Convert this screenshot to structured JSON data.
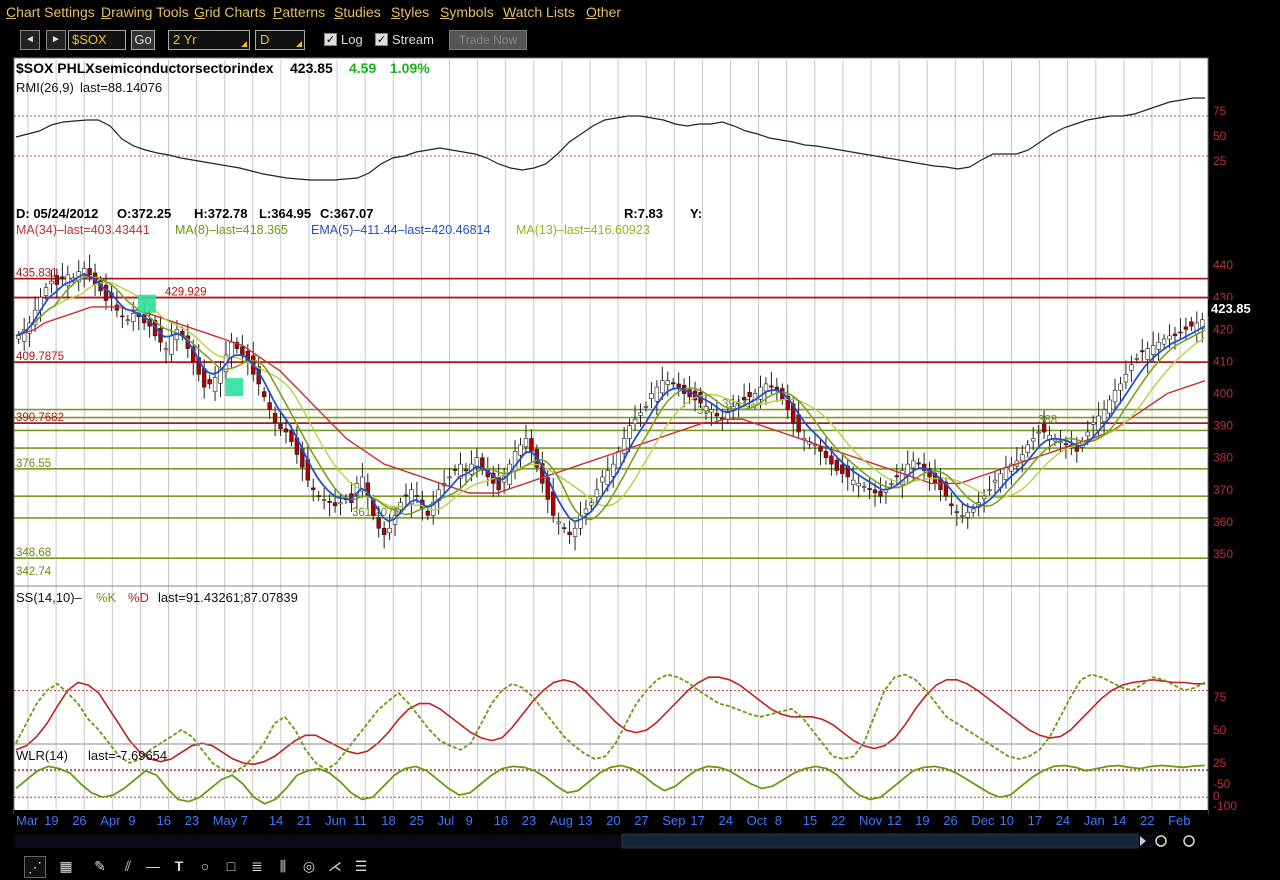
{
  "menu": [
    "Chart Settings",
    "Drawing Tools",
    "Grid Charts",
    "Patterns",
    "Studies",
    "Styles",
    "Symbols",
    "Watch Lists",
    "Other"
  ],
  "toolbar": {
    "back_label": "◄",
    "forward_label": "►",
    "symbol": "$SOX",
    "go_label": "Go",
    "period": "2 Yr",
    "interval": "D",
    "log_label": "Log",
    "log_checked": "✓",
    "stream_label": "Stream",
    "stream_checked": "✓",
    "trade_label": "Trade Now"
  },
  "colors": {
    "accent_menu": "#e8c05a",
    "price_up": "#ffffff",
    "price_down": "#b00000",
    "ma34": "#c83030",
    "ma8": "#7aa020",
    "ema5": "#2050d0",
    "ma13": "#b8d040",
    "rmi": "#222222",
    "k_line": "#6a9a10",
    "d_line": "#c02020",
    "level_red": "#b01818",
    "level_green": "#7a9a20",
    "signal_box": "#2ee0a0"
  },
  "chart_data": [
    {
      "type": "line",
      "panel": "price-header",
      "title": "$SOX PHLXsemiconductorsectorindex",
      "last": "423.85",
      "change": "4.59",
      "change_pct": "1.09%",
      "readout": {
        "date": "05/24/2012",
        "open": "372.25",
        "high": "372.78",
        "low": "364.95",
        "close": "367.07",
        "r": "R:7.83",
        "y": "Y:"
      }
    },
    {
      "type": "line",
      "panel": "rmi",
      "legend": "RMI(26,9)",
      "last_label": "last=88.14076",
      "ylim": [
        0,
        100
      ],
      "yticks": [
        25,
        50,
        75
      ],
      "reference_lines": [
        30,
        70
      ],
      "x": [
        0,
        4,
        8,
        12,
        16,
        20,
        24,
        28,
        32,
        36,
        40,
        44,
        48,
        52,
        56,
        60,
        64,
        68,
        72,
        76,
        80,
        84,
        88,
        92,
        96,
        100,
        104,
        108,
        112,
        116,
        120,
        124,
        128,
        132,
        136,
        140,
        144,
        148,
        152,
        156,
        160,
        164,
        168,
        172,
        176,
        180,
        184,
        188,
        192,
        196,
        200,
        204,
        208,
        212,
        216,
        220,
        224,
        228,
        232,
        236,
        240,
        244,
        248,
        252,
        256,
        260,
        264,
        268,
        272,
        276,
        280,
        284,
        288,
        292,
        296,
        300,
        304,
        308,
        312,
        316,
        320,
        324,
        328,
        332,
        336,
        340,
        344,
        348,
        352
      ],
      "values": [
        49,
        52,
        55,
        61,
        64,
        65,
        66,
        66,
        60,
        47,
        40,
        36,
        33,
        31,
        28,
        26,
        24,
        22,
        20,
        18,
        15,
        12,
        10,
        8,
        7,
        6,
        6,
        6,
        7,
        8,
        13,
        22,
        28,
        30,
        34,
        36,
        38,
        36,
        34,
        32,
        28,
        22,
        18,
        16,
        18,
        22,
        32,
        44,
        52,
        60,
        66,
        68,
        70,
        70,
        68,
        66,
        62,
        60,
        62,
        62,
        64,
        60,
        55,
        52,
        48,
        46,
        44,
        41,
        40,
        38,
        36,
        34,
        32,
        30,
        28,
        26,
        24,
        22,
        20,
        19,
        17,
        19,
        26,
        32,
        32,
        32,
        36,
        44,
        52,
        58,
        62,
        66,
        68,
        70,
        70,
        72,
        76,
        80,
        84,
        86,
        88,
        88
      ]
    },
    {
      "type": "line",
      "panel": "price",
      "date_readout": "D: 05/24/2012",
      "legends": [
        {
          "name": "MA(34)",
          "last": "last=403.43441"
        },
        {
          "name": "MA(8)",
          "last": "last=418.365"
        },
        {
          "name": "EMA(5)",
          "value": "411.44",
          "last": "last=420.46814"
        },
        {
          "name": "MA(13)",
          "last": "last=416.60923"
        }
      ],
      "ylim": [
        340,
        446
      ],
      "yticks": [
        350,
        360,
        370,
        380,
        390,
        400,
        410,
        420,
        430,
        440
      ],
      "last_price_tag": "423.85",
      "levels_red": [
        435.83,
        429.929,
        409.7875,
        390.7682
      ],
      "levels_green": [
        395,
        392.5,
        388.5,
        383,
        376.55,
        368,
        361.2071,
        348.68
      ],
      "level_labels": [
        {
          "text": "435.831",
          "value": 435.83
        },
        {
          "text": "429.929",
          "value": 429.929
        },
        {
          "text": "409.7875",
          "value": 409.7875
        },
        {
          "text": "390.7682",
          "value": 390.7682
        },
        {
          "text": "376.55",
          "value": 376.55
        },
        {
          "text": "361.2071",
          "value": 361.2071
        },
        {
          "text": "348.68",
          "value": 348.68
        },
        {
          "text": "342.74",
          "value": 342.74
        },
        {
          "text": "394.03",
          "value": 395
        },
        {
          "text": "39",
          "value": 393
        },
        {
          "text": "388",
          "value": 390
        }
      ],
      "signal_boxes": [
        {
          "x_index": 24,
          "value": 428
        },
        {
          "x_index": 40,
          "value": 402
        },
        {
          "x_index": 266,
          "value": 388
        }
      ],
      "close": [
        418,
        420,
        422,
        426,
        430,
        433,
        435,
        434,
        436,
        437,
        436,
        438,
        439,
        437,
        434,
        432,
        429,
        430,
        426,
        424,
        423,
        425,
        424,
        422,
        421,
        418,
        416,
        414,
        418,
        420,
        418,
        414,
        410,
        406,
        402,
        403,
        405,
        408,
        412,
        416,
        414,
        412,
        410,
        406,
        403,
        399,
        395,
        391,
        389,
        388,
        385,
        381,
        377,
        373,
        370,
        368,
        367,
        366,
        365,
        366,
        367,
        366,
        372,
        374,
        368,
        362,
        358,
        356,
        358,
        362,
        366,
        368,
        370,
        368,
        364,
        362,
        366,
        370,
        372,
        374,
        376,
        378,
        376,
        378,
        380,
        376,
        374,
        372,
        370,
        374,
        378,
        382,
        384,
        386,
        382,
        377,
        372,
        367,
        362,
        360,
        358,
        356,
        358,
        362,
        364,
        366,
        370,
        374,
        376,
        378,
        382,
        386,
        390,
        392,
        394,
        396,
        400,
        402,
        404,
        404,
        403,
        402,
        400,
        399,
        398,
        397,
        396,
        395,
        393,
        392,
        394,
        396,
        397,
        398,
        399,
        400,
        402,
        403,
        402,
        401,
        398,
        395,
        391,
        388,
        386,
        385,
        384,
        382,
        380,
        378,
        376,
        375,
        374,
        373,
        372,
        371,
        370,
        369,
        368,
        370,
        372,
        374,
        376,
        378,
        379,
        378,
        376,
        374,
        372,
        370,
        368,
        365,
        363,
        362,
        363,
        364,
        366,
        368,
        370,
        373,
        375,
        377,
        378,
        379,
        381,
        384,
        386,
        388,
        388,
        387,
        386,
        385,
        384,
        383,
        382,
        385,
        388,
        391,
        393,
        395,
        398,
        401,
        403,
        406,
        409,
        411,
        413,
        414,
        415,
        416,
        417,
        418,
        418,
        419,
        420,
        421,
        422,
        423
      ],
      "ma34": [
        418,
        419,
        420,
        422,
        423,
        424,
        425,
        426,
        427,
        427,
        427,
        427,
        426,
        426,
        425,
        424,
        423,
        422,
        421,
        420,
        419,
        418,
        417,
        416,
        415,
        413,
        411,
        409,
        407,
        404,
        401,
        398,
        395,
        392,
        389,
        386,
        384,
        382,
        380,
        378,
        377,
        376,
        375,
        374,
        373,
        372,
        371,
        370,
        369,
        369,
        369,
        369,
        370,
        371,
        372,
        373,
        374,
        375,
        376,
        377,
        378,
        379,
        380,
        381,
        382,
        383,
        384,
        385,
        386,
        387,
        388,
        389,
        390,
        391,
        391,
        392,
        392,
        392,
        391,
        390,
        389,
        388,
        387,
        386,
        385,
        384,
        383,
        382,
        381,
        380,
        379,
        378,
        377,
        376,
        375,
        374,
        373,
        372,
        372,
        372,
        372,
        373,
        374,
        375,
        376,
        377,
        378,
        379,
        380,
        381,
        382,
        383,
        384,
        385,
        386,
        387,
        388,
        390,
        392,
        394,
        396,
        398,
        400,
        401,
        402,
        403,
        404
      ],
      "x_labels": [
        "Mar",
        "19",
        "26",
        "Apr",
        "9",
        "16",
        "23",
        "May",
        "7",
        "14",
        "21",
        "Jun",
        "11",
        "18",
        "25",
        "Jul",
        "9",
        "16",
        "23",
        "Aug",
        "13",
        "20",
        "27",
        "Sep",
        "17",
        "24",
        "Oct",
        "8",
        "15",
        "22",
        "Nov",
        "12",
        "19",
        "26",
        "Dec",
        "10",
        "17",
        "24",
        "Jan",
        "14",
        "22",
        "Feb"
      ]
    },
    {
      "type": "line",
      "panel": "stochastic",
      "legend": "SS(14,10)",
      "series": [
        {
          "name": "%K",
          "values": [
            40,
            55,
            70,
            80,
            85,
            78,
            70,
            58,
            50,
            40,
            30,
            25,
            28,
            35,
            40,
            45,
            50,
            45,
            35,
            25,
            20,
            18,
            22,
            30,
            40,
            55,
            60,
            50,
            35,
            25,
            20,
            25,
            35,
            45,
            55,
            65,
            72,
            78,
            70,
            60,
            50,
            42,
            38,
            35,
            40,
            55,
            70,
            80,
            85,
            82,
            75,
            65,
            55,
            45,
            38,
            32,
            28,
            30,
            40,
            55,
            70,
            80,
            88,
            92,
            90,
            86,
            80,
            75,
            70,
            68,
            65,
            62,
            60,
            62,
            64,
            66,
            60,
            50,
            40,
            30,
            28,
            30,
            40,
            60,
            80,
            90,
            92,
            88,
            80,
            70,
            60,
            55,
            50,
            45,
            40,
            35,
            30,
            28,
            30,
            35,
            45,
            60,
            75,
            88,
            92,
            90,
            86,
            82,
            80,
            85,
            90,
            88,
            84,
            80,
            82,
            86
          ]
        },
        {
          "name": "%D",
          "values": [
            35,
            38,
            45,
            55,
            68,
            80,
            86,
            84,
            78,
            66,
            54,
            42,
            33,
            28,
            26,
            28,
            33,
            38,
            40,
            38,
            33,
            28,
            25,
            24,
            26,
            30,
            36,
            42,
            46,
            46,
            42,
            38,
            34,
            32,
            34,
            40,
            48,
            58,
            66,
            70,
            70,
            66,
            60,
            54,
            48,
            44,
            42,
            44,
            52,
            62,
            72,
            80,
            86,
            88,
            86,
            80,
            72,
            64,
            56,
            50,
            48,
            50,
            56,
            64,
            72,
            80,
            86,
            90,
            90,
            88,
            84,
            78,
            72,
            66,
            62,
            60,
            60,
            60,
            58,
            54,
            48,
            42,
            38,
            36,
            38,
            44,
            54,
            66,
            76,
            84,
            88,
            88,
            85,
            80,
            74,
            68,
            62,
            56,
            50,
            46,
            44,
            45,
            50,
            58,
            66,
            74,
            80,
            84,
            86,
            87,
            88,
            87,
            86,
            86,
            85,
            85
          ]
        }
      ],
      "d_last": "last=91.43261;87.07839",
      "ylim": [
        0,
        100
      ],
      "yticks": [
        0,
        25,
        50,
        75
      ],
      "reference_lines": [
        20,
        80
      ]
    },
    {
      "type": "line",
      "panel": "williams",
      "legend": "WLR(14)",
      "last_label": "last=-7.69654",
      "ylim": [
        -100,
        0
      ],
      "yticks": [
        -50,
        -100
      ],
      "reference_lines": [
        -20,
        -80
      ],
      "values": [
        -60,
        -40,
        -20,
        -10,
        -15,
        -25,
        -50,
        -70,
        -80,
        -75,
        -60,
        -40,
        -20,
        -30,
        -60,
        -85,
        -90,
        -80,
        -60,
        -40,
        -30,
        -50,
        -80,
        -95,
        -85,
        -60,
        -30,
        -20,
        -15,
        -25,
        -45,
        -70,
        -85,
        -80,
        -55,
        -30,
        -15,
        -10,
        -20,
        -40,
        -60,
        -75,
        -70,
        -50,
        -30,
        -15,
        -10,
        -12,
        -20,
        -35,
        -55,
        -70,
        -65,
        -45,
        -25,
        -12,
        -8,
        -15,
        -30,
        -50,
        -65,
        -55,
        -35,
        -18,
        -10,
        -12,
        -20,
        -35,
        -50,
        -60,
        -55,
        -40,
        -25,
        -15,
        -10,
        -15,
        -30,
        -55,
        -75,
        -85,
        -80,
        -60,
        -40,
        -20,
        -12,
        -10,
        -15,
        -25,
        -40,
        -55,
        -70,
        -80,
        -75,
        -55,
        -35,
        -20,
        -10,
        -8,
        -12,
        -20,
        -15,
        -10,
        -8,
        -12,
        -15,
        -10,
        -8,
        -10,
        -12,
        -9,
        -8
      ]
    }
  ],
  "bottom_tools": [
    "cursor-tool",
    "crosshair-tool",
    "line-tool",
    "hline-tool",
    "text-tool",
    "ellipse-tool",
    "rect-tool",
    "fib-tool",
    "channel-tool",
    "gann-tool",
    "pitchfork-tool",
    "grid-tool"
  ]
}
